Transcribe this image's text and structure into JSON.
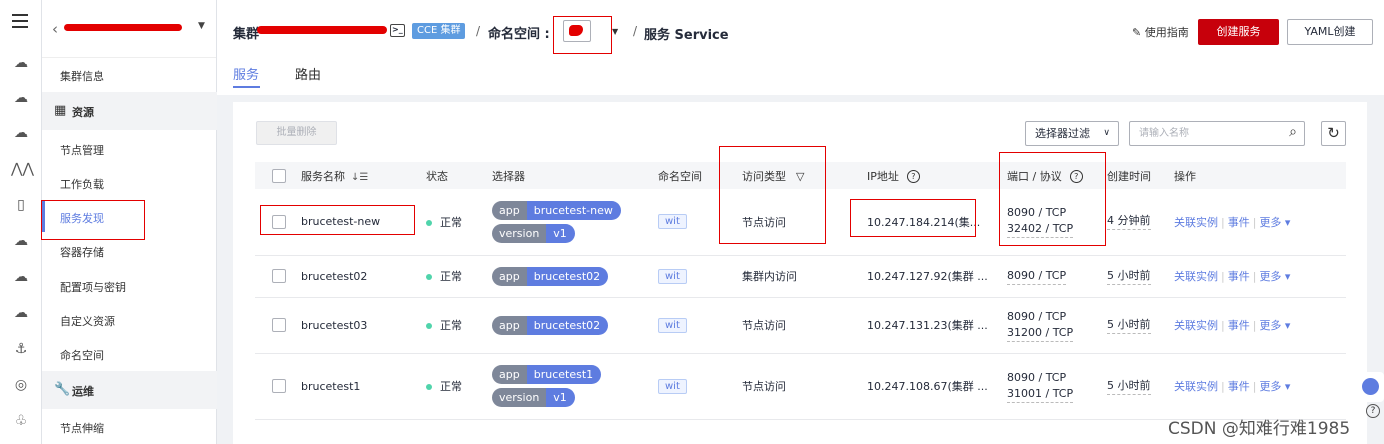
{
  "rail": {
    "icons": [
      "menu-icon",
      "cloud-icon",
      "cloud-storage-icon",
      "database-icon",
      "network-icon",
      "server-icon",
      "cloud-outline-icon",
      "cloud-upload-icon",
      "cloud-sync-icon",
      "anchor-icon",
      "globe-icon",
      "cluster-icon"
    ]
  },
  "sidebar": {
    "cluster_name": "cluster-redacted",
    "items": [
      {
        "label": "集群信息"
      },
      {
        "label": "资源",
        "group": true
      },
      {
        "label": "节点管理"
      },
      {
        "label": "工作负载"
      },
      {
        "label": "服务发现",
        "active": true
      },
      {
        "label": "容器存储"
      },
      {
        "label": "配置项与密钥"
      },
      {
        "label": "自定义资源"
      },
      {
        "label": "命名空间"
      },
      {
        "label": "运维",
        "group": true
      },
      {
        "label": "节点伸缩"
      }
    ]
  },
  "header": {
    "cluster_label": "集群",
    "cce_badge": "CCE 集群",
    "sep": "/",
    "namespace_label": "命名空间 :",
    "title": "服务 Service",
    "guide_label": "使用指南",
    "create_label": "创建服务",
    "yaml_label": "YAML创建"
  },
  "tabs": [
    {
      "label": "服务",
      "active": true
    },
    {
      "label": "路由",
      "active": false
    }
  ],
  "toolbar": {
    "batch_delete_label": "批量删除",
    "filter_label": "选择器过滤",
    "search_placeholder": "请输入名称"
  },
  "table": {
    "columns": [
      "服务名称",
      "状态",
      "选择器",
      "命名空间",
      "访问类型",
      "IP地址",
      "端口 / 协议",
      "创建时间",
      "操作"
    ],
    "rows": [
      {
        "name": "brucetest-new",
        "status": "正常",
        "selectors": [
          {
            "k": "app",
            "v": "brucetest-new"
          },
          {
            "k": "version",
            "v": "v1"
          }
        ],
        "namespace": "wit",
        "access": "节点访问",
        "ip": "10.247.184.214(集...",
        "ports": [
          "8090 / TCP",
          "32402 / TCP"
        ],
        "created": "4 分钟前"
      },
      {
        "name": "brucetest02",
        "status": "正常",
        "selectors": [
          {
            "k": "app",
            "v": "brucetest02"
          }
        ],
        "namespace": "wit",
        "access": "集群内访问",
        "ip": "10.247.127.92(集群 ...",
        "ports": [
          "8090 / TCP"
        ],
        "created": "5 小时前"
      },
      {
        "name": "brucetest03",
        "status": "正常",
        "selectors": [
          {
            "k": "app",
            "v": "brucetest02"
          }
        ],
        "namespace": "wit",
        "access": "节点访问",
        "ip": "10.247.131.23(集群 ...",
        "ports": [
          "8090 / TCP",
          "31200 / TCP"
        ],
        "created": "5 小时前"
      },
      {
        "name": "brucetest1",
        "status": "正常",
        "selectors": [
          {
            "k": "app",
            "v": "brucetest1"
          },
          {
            "k": "version",
            "v": "v1"
          }
        ],
        "namespace": "wit",
        "access": "节点访问",
        "ip": "10.247.108.67(集群 ...",
        "ports": [
          "8090 / TCP",
          "31001 / TCP"
        ],
        "created": "5 小时前"
      }
    ],
    "ops": [
      "关联实例",
      "事件",
      "更多 ▾"
    ]
  },
  "watermark": "CSDN @知难行难1985",
  "colors": {
    "accent": "#5e7ce0",
    "brand_red": "#c7000b",
    "annotation_red": "#e30000",
    "status_ok": "#50d4ab"
  }
}
